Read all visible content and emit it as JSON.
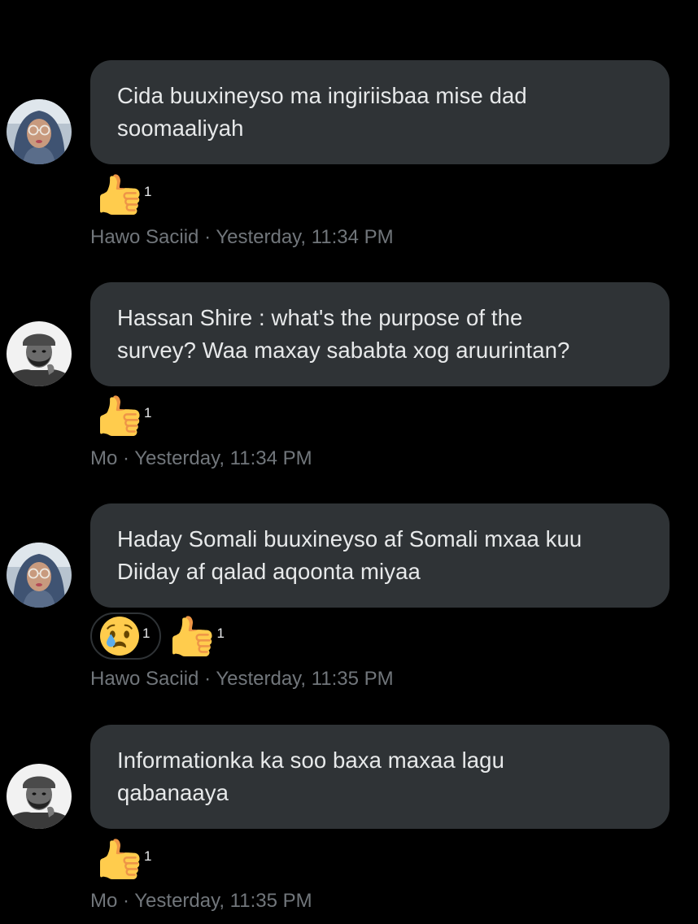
{
  "messages": [
    {
      "author": "Hawo Saciid",
      "time": "Yesterday, 11:34 PM",
      "separator": " · ",
      "text_line1": "Cida buuxineyso ma ingiriisbaa mise dad",
      "text_line2": "soomaaliyah",
      "reactions": [
        {
          "emoji": "thumbs-up-icon",
          "count": "1"
        }
      ]
    },
    {
      "author": "Mo",
      "time": "Yesterday, 11:34 PM",
      "separator": " · ",
      "text_line1": "Hassan Shire : what's the purpose of the",
      "text_line2": "survey? Waa maxay sababta xog aruurintan?",
      "reactions": [
        {
          "emoji": "thumbs-up-icon",
          "count": "1"
        }
      ]
    },
    {
      "author": "Hawo Saciid",
      "time": "Yesterday, 11:35 PM",
      "separator": " · ",
      "text_line1": "Haday Somali buuxineyso af Somali mxaa kuu",
      "text_line2": "Diiday af qalad aqoonta miyaa",
      "reactions": [
        {
          "emoji": "crying-face-icon",
          "count": "1",
          "selected": true
        },
        {
          "emoji": "thumbs-up-icon",
          "count": "1"
        }
      ]
    },
    {
      "author": "Mo",
      "time": "Yesterday, 11:35 PM",
      "separator": " · ",
      "text_line1": "Informationka ka soo baxa maxaa lagu",
      "text_line2": "qabanaaya",
      "reactions": [
        {
          "emoji": "thumbs-up-icon",
          "count": "1"
        }
      ]
    }
  ],
  "colors": {
    "background": "#000000",
    "bubble": "#2f3336",
    "text": "#e7e9ea",
    "meta": "#71767b"
  }
}
